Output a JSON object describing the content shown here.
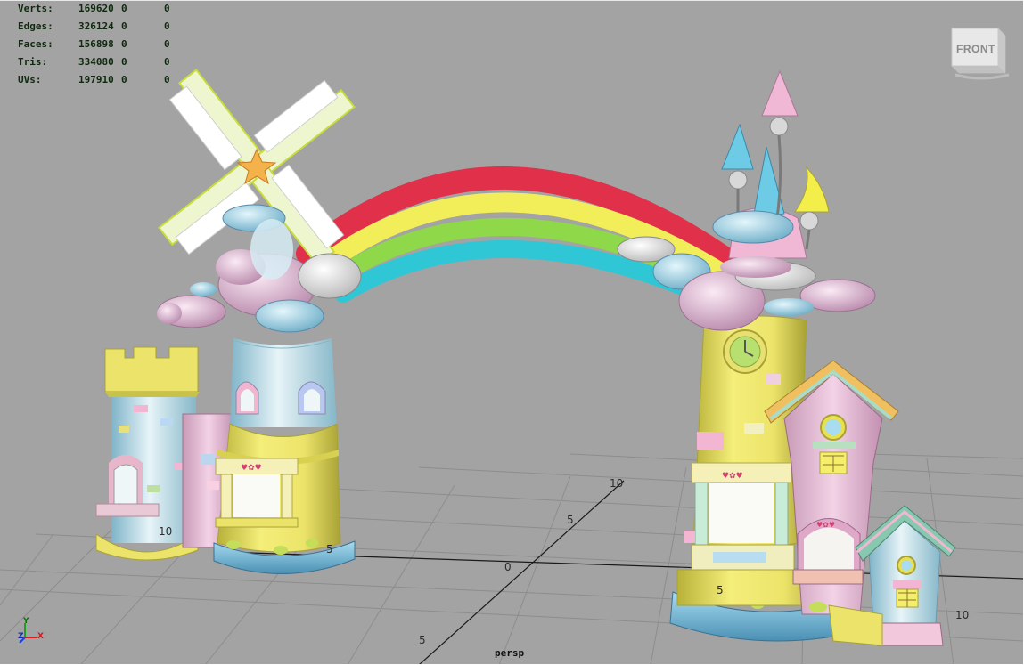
{
  "hud": {
    "rows": [
      {
        "label": "Verts:",
        "v1": "169620",
        "v2": "0",
        "v3": "0"
      },
      {
        "label": "Edges:",
        "v1": "326124",
        "v2": "0",
        "v3": "0"
      },
      {
        "label": "Faces:",
        "v1": "156898",
        "v2": "0",
        "v3": "0"
      },
      {
        "label": "Tris:",
        "v1": "334080",
        "v2": "0",
        "v3": "0"
      },
      {
        "label": "UVs:",
        "v1": "197910",
        "v2": "0",
        "v3": "0"
      }
    ]
  },
  "camera": {
    "name": "persp"
  },
  "viewcube": {
    "face": "FRONT"
  },
  "axis": {
    "x": "X",
    "y": "Y",
    "z": "Z"
  },
  "grid_labels": [
    "10",
    "5",
    "0",
    "5",
    "10",
    "5",
    "10",
    "5"
  ],
  "colors": {
    "viewport_bg": "#a3a3a3",
    "grid_line": "#8a8a8a",
    "grid_axis": "#1a1a1a",
    "rainbow_red": "#e0304a",
    "rainbow_yellow": "#f2ee5a",
    "rainbow_green": "#8ed84a",
    "rainbow_cyan": "#2fc6d6",
    "tower_yellow": "#ece46a",
    "pastel_pink": "#eab9d6",
    "pastel_blue": "#a9d6ea"
  }
}
